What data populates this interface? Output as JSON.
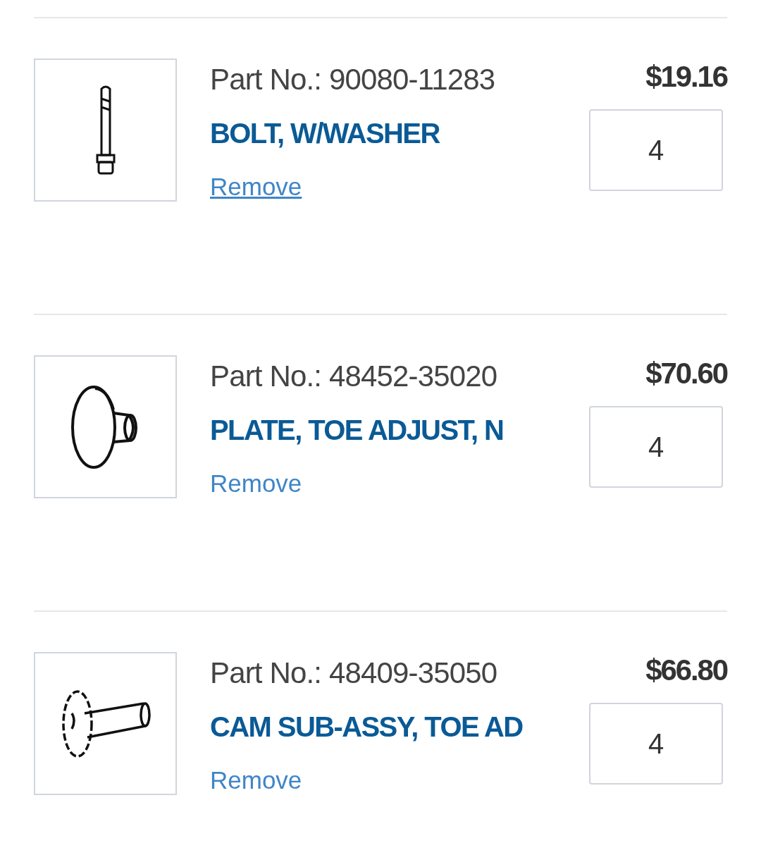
{
  "items": [
    {
      "part_no": "Part No.: 90080-11283",
      "name": "BOLT, W/WASHER",
      "remove": "Remove",
      "focused": true,
      "price": "$19.16",
      "quantity": "4",
      "kind": "bolt"
    },
    {
      "part_no": "Part No.: 48452-35020",
      "name": "PLATE, TOE ADJUST, N",
      "remove": "Remove",
      "focused": false,
      "price": "$70.60",
      "quantity": "4",
      "kind": "plate"
    },
    {
      "part_no": "Part No.: 48409-35050",
      "name": "CAM SUB-ASSY, TOE AD",
      "remove": "Remove",
      "focused": false,
      "price": "$66.80",
      "quantity": "4",
      "kind": "cam"
    }
  ]
}
